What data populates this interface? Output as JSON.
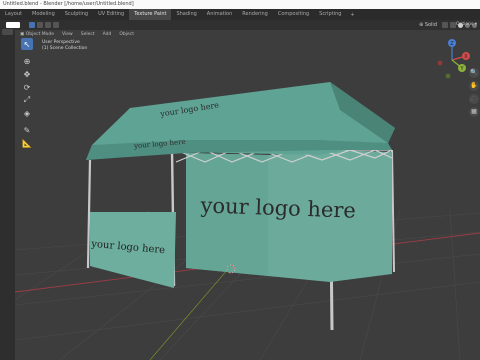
{
  "window": {
    "title": "Untitled.blend - Blender [/home/user/Untitled.blend]"
  },
  "workspaces": {
    "tabs": [
      "Layout",
      "Modeling",
      "Sculpting",
      "UV Editing",
      "Texture Paint",
      "Shading",
      "Animation",
      "Rendering",
      "Compositing",
      "Scripting",
      "+"
    ],
    "active": "Texture Paint"
  },
  "header": {
    "viewport_shading": "Solid",
    "options_label": "Options ▾"
  },
  "tool_header": {
    "mode": "Object Mode",
    "menus": [
      "View",
      "Select",
      "Add",
      "Object"
    ]
  },
  "viewport": {
    "view_name": "User Perspective",
    "collection": "(1) Scene Collection",
    "canopy_text": "your logo here",
    "wall_text": "your logo here",
    "front_text": "your logo here",
    "canopy_color": "#5fa394",
    "grid_color": "#4a4a4a",
    "x_axis_color": "#9c3c47",
    "y_axis_color": "#7d9c2c"
  },
  "gizmo": {
    "x_label": "X",
    "y_label": "Y",
    "z_label": "Z"
  },
  "icons": [
    "select-box-icon",
    "cursor-icon",
    "move-icon",
    "rotate-icon",
    "scale-icon",
    "transform-icon",
    "annotate-icon",
    "measure-icon",
    "zoom-icon",
    "hand-icon",
    "camera-icon",
    "grid-icon"
  ]
}
